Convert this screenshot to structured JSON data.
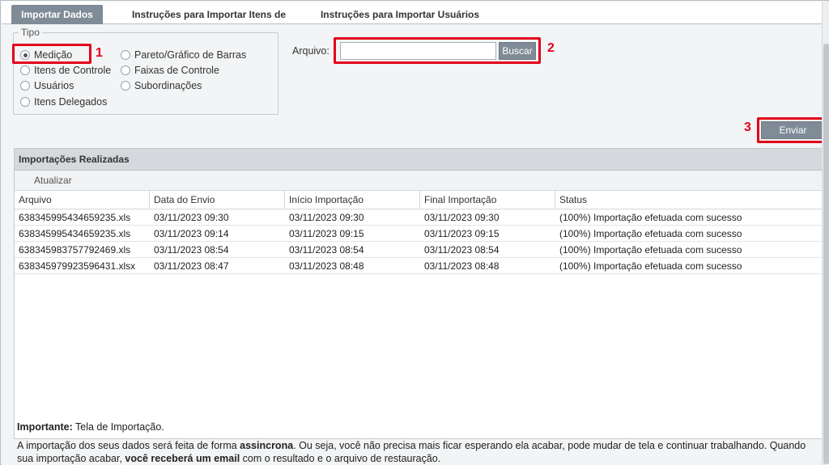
{
  "tabs": [
    {
      "label": "Importar Dados",
      "active": true
    },
    {
      "label": "Instruções para Importar Itens de Controle",
      "active": false
    },
    {
      "label": "Instruções para Importar Usuários",
      "active": false
    }
  ],
  "tipo": {
    "legend": "Tipo",
    "options": [
      {
        "label": "Medição",
        "checked": true
      },
      {
        "label": "Itens de Controle",
        "checked": false
      },
      {
        "label": "Usuários",
        "checked": false
      },
      {
        "label": "Itens Delegados",
        "checked": false
      },
      {
        "label": "Pareto/Gráfico de Barras",
        "checked": false
      },
      {
        "label": "Faixas de Controle",
        "checked": false
      },
      {
        "label": "Subordinações",
        "checked": false
      }
    ]
  },
  "arquivo": {
    "label": "Arquivo:",
    "value": "",
    "browse_label": "Buscar"
  },
  "send_label": "Enviar",
  "callouts": [
    "1",
    "2",
    "3"
  ],
  "grid": {
    "title": "Importações Realizadas",
    "refresh_label": "Atualizar",
    "columns": [
      "Arquivo",
      "Data do Envio",
      "Início Importação",
      "Final Importação",
      "Status"
    ],
    "rows": [
      [
        "638345995434659235.xls",
        "03/11/2023 09:30",
        "03/11/2023 09:30",
        "03/11/2023 09:30",
        "(100%) Importação efetuada com sucesso"
      ],
      [
        "638345995434659235.xls",
        "03/11/2023 09:14",
        "03/11/2023 09:15",
        "03/11/2023 09:15",
        "(100%) Importação efetuada com sucesso"
      ],
      [
        "638345983757792469.xls",
        "03/11/2023 08:54",
        "03/11/2023 08:54",
        "03/11/2023 08:54",
        "(100%) Importação efetuada com sucesso"
      ],
      [
        "638345979923596431.xlsx",
        "03/11/2023 08:47",
        "03/11/2023 08:48",
        "03/11/2023 08:48",
        "(100%) Importação efetuada com sucesso"
      ]
    ]
  },
  "notes": {
    "important_label": "Importante:",
    "important_text": " Tela de Importação.",
    "p2_a": "A importação dos seus dados será feita de forma ",
    "p2_b": "assincrona",
    "p2_c": ". Ou seja, você não precisa mais ficar esperando ela acabar, pode mudar de tela e continuar trabalhando. Quando sua importação acabar, ",
    "p2_d": "você receberá um email",
    "p2_e": " com o resultado e o arquivo de restauração."
  },
  "colors": {
    "accent": "#7f8b97",
    "highlight": "#e2001a"
  }
}
